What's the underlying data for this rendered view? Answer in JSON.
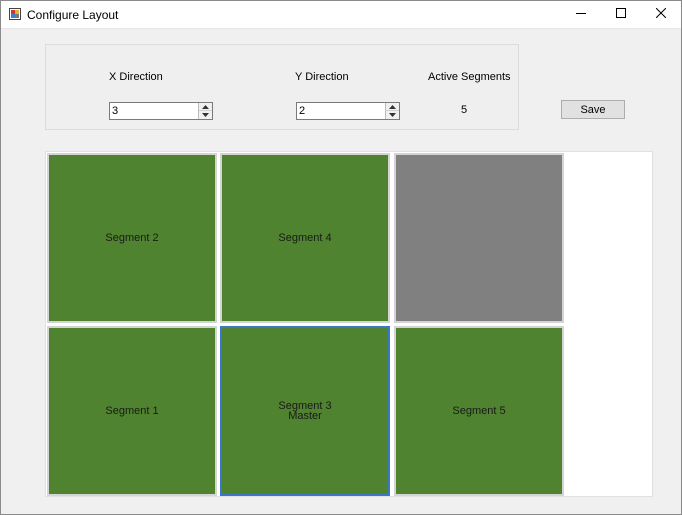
{
  "window": {
    "title": "Configure Layout",
    "minimize_icon": "minimize-icon",
    "maximize_icon": "maximize-icon",
    "close_icon": "close-icon"
  },
  "settings": {
    "x_direction_label": "X Direction",
    "x_direction_value": "3",
    "y_direction_label": "Y Direction",
    "y_direction_value": "2",
    "active_segments_label": "Active Segments",
    "active_segments_value": "5"
  },
  "save_button": {
    "label": "Save"
  },
  "segments": [
    {
      "label": "Segment 2",
      "sub": "",
      "color": "#4f832f"
    },
    {
      "label": "Segment 4",
      "sub": "",
      "color": "#4f832f"
    },
    {
      "label": "",
      "sub": "",
      "color": "#808080"
    },
    {
      "label": "Segment 1",
      "sub": "",
      "color": "#4f832f"
    },
    {
      "label": "Segment 3",
      "sub": "Master",
      "color": "#4f832f",
      "selected": true
    },
    {
      "label": "Segment 5",
      "sub": "",
      "color": "#4f832f"
    }
  ],
  "colors": {
    "active_segment": "#4f832f",
    "inactive_segment": "#808080",
    "selection_border": "#3a78c8"
  }
}
